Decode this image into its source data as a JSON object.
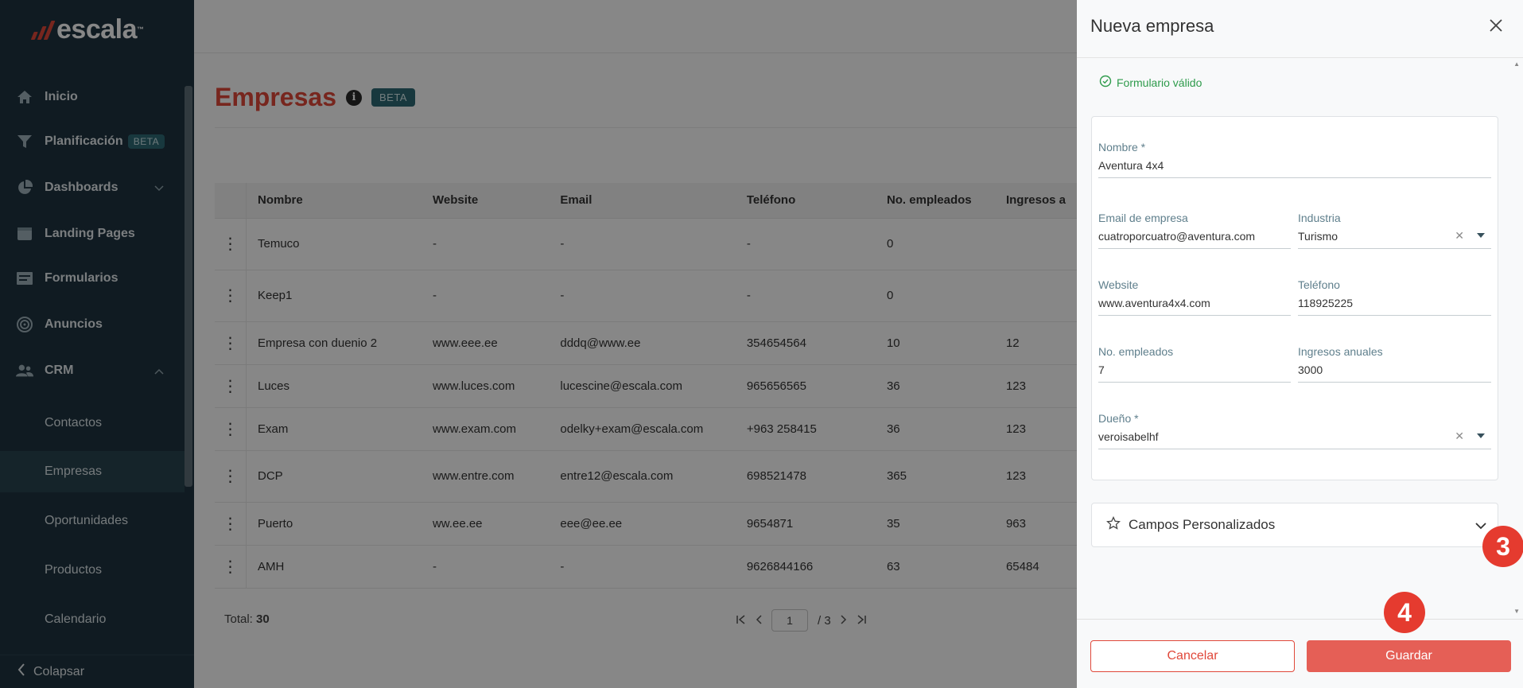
{
  "sidebar": {
    "brand": "escala",
    "trademark": "™",
    "items": [
      {
        "label": "Inicio",
        "icon": "home-icon"
      },
      {
        "label": "Planificación",
        "icon": "funnel-icon",
        "badge": "BETA"
      },
      {
        "label": "Dashboards",
        "icon": "pie-chart-icon"
      },
      {
        "label": "Landing Pages",
        "icon": "browser-icon"
      },
      {
        "label": "Formularios",
        "icon": "form-icon"
      },
      {
        "label": "Anuncios",
        "icon": "megaphone-icon"
      },
      {
        "label": "CRM",
        "icon": "people-icon"
      }
    ],
    "crm_items": [
      {
        "label": "Contactos"
      },
      {
        "label": "Empresas"
      },
      {
        "label": "Oportunidades"
      },
      {
        "label": "Productos"
      },
      {
        "label": "Calendario"
      }
    ],
    "collapse_label": "Colapsar"
  },
  "main": {
    "title": "Empresas",
    "badge": "BETA",
    "columns": [
      "Nombre",
      "Website",
      "Email",
      "Teléfono",
      "No. empleados",
      "Ingresos a"
    ],
    "rows": [
      [
        "Temuco",
        "-",
        "-",
        "-",
        "0",
        ""
      ],
      [
        "Keep1",
        "-",
        "-",
        "-",
        "0",
        ""
      ],
      [
        "Empresa con duenio 2",
        "www.eee.ee",
        "dddq@www.ee",
        "354654564",
        "10",
        "12"
      ],
      [
        "Luces",
        "www.luces.com",
        "lucescine@escala.com",
        "965656565",
        "36",
        "123"
      ],
      [
        "Exam",
        "www.exam.com",
        "odelky+exam@escala.com",
        "+963 258415",
        "36",
        "123"
      ],
      [
        "DCP",
        "www.entre.com",
        "entre12@escala.com",
        "698521478",
        "365",
        "123"
      ],
      [
        "Puerto",
        "ww.ee.ee",
        "eee@ee.ee",
        "9654871",
        "35",
        "963"
      ],
      [
        "AMH",
        "-",
        "-",
        "9626844166",
        "63",
        "65484"
      ]
    ],
    "total_label": "Total:",
    "total_value": "30",
    "page_current": "1",
    "page_total": "/ 3"
  },
  "drawer": {
    "title": "Nueva empresa",
    "valid_text": "Formulario válido",
    "fields": {
      "nombre": {
        "label": "Nombre *",
        "value": "Aventura 4x4"
      },
      "email": {
        "label": "Email de empresa",
        "value": "cuatroporcuatro@aventura.com"
      },
      "industria": {
        "label": "Industria",
        "value": "Turismo"
      },
      "website": {
        "label": "Website",
        "value": "www.aventura4x4.com"
      },
      "telefono": {
        "label": "Teléfono",
        "value": "118925225"
      },
      "empleados": {
        "label": "No. empleados",
        "value": "7"
      },
      "ingresos": {
        "label": "Ingresos anuales",
        "value": "3000"
      },
      "dueno": {
        "label": "Dueño *",
        "value": "veroisabelhf"
      }
    },
    "custom_fields_label": "Campos Personalizados",
    "cancel_label": "Cancelar",
    "save_label": "Guardar"
  },
  "annotations": {
    "step3": "3",
    "step4": "4"
  },
  "colors": {
    "brand": "#e0483a",
    "sidebar": "#1f3440",
    "valid": "#2e9b4b",
    "save": "#e55f56"
  }
}
